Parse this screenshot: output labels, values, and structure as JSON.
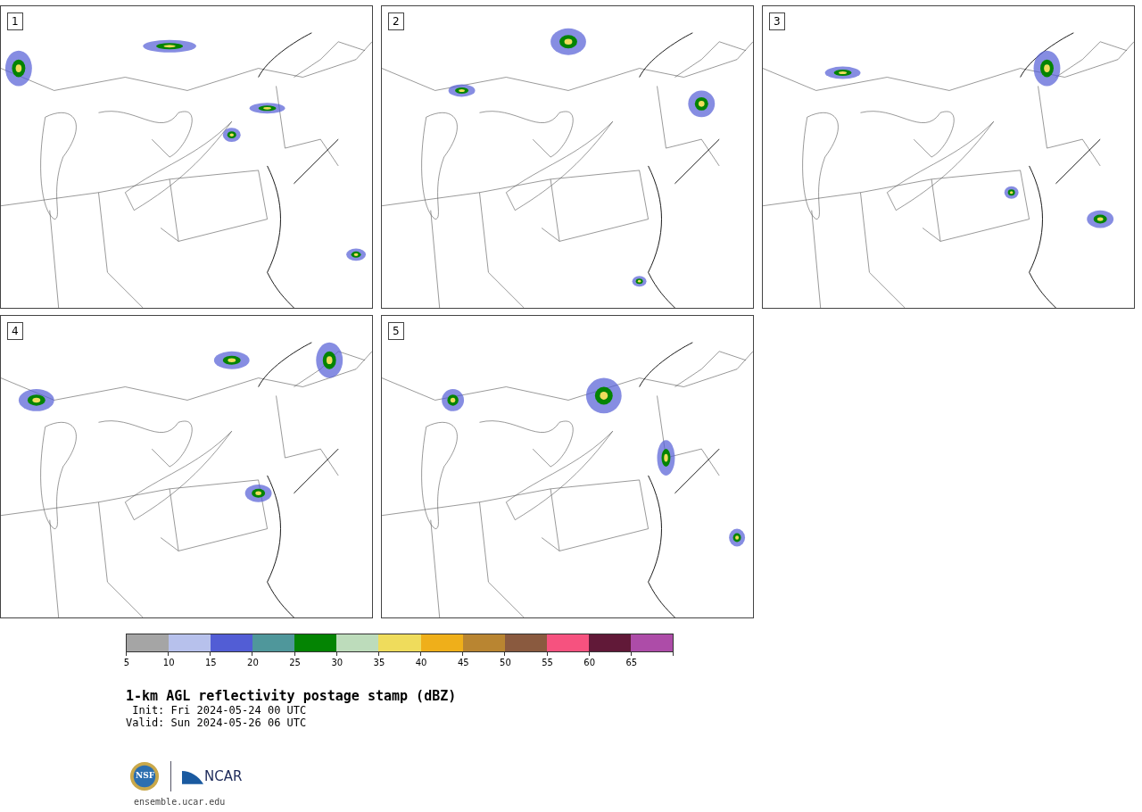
{
  "panels": [
    {
      "number": "1"
    },
    {
      "number": "2"
    },
    {
      "number": "3"
    },
    {
      "number": "4"
    },
    {
      "number": "5"
    }
  ],
  "colorbar": {
    "bins": [
      {
        "color": "#a5a5a5",
        "label": "5"
      },
      {
        "color": "#b7c1ec",
        "label": "10"
      },
      {
        "color": "#525dd5",
        "label": "15"
      },
      {
        "color": "#4f979b",
        "label": "20"
      },
      {
        "color": "#048403",
        "label": "25"
      },
      {
        "color": "#bddcbb",
        "label": "30"
      },
      {
        "color": "#efdc5c",
        "label": "35"
      },
      {
        "color": "#efaf1a",
        "label": "40"
      },
      {
        "color": "#b98531",
        "label": "45"
      },
      {
        "color": "#8a5a3f",
        "label": "50"
      },
      {
        "color": "#f6527f",
        "label": "55"
      },
      {
        "color": "#611938",
        "label": "60"
      },
      {
        "color": "#ad4ca8",
        "label": "65"
      }
    ]
  },
  "title": "1-km AGL reflectivity postage stamp (dBZ)",
  "init": " Init: Fri 2024-05-24 00 UTC",
  "valid": "Valid: Sun 2024-05-26 06 UTC",
  "logo": {
    "emblem_text": "NSF",
    "wordmark": "NCAR"
  },
  "footer_url": "ensemble.ucar.edu"
}
